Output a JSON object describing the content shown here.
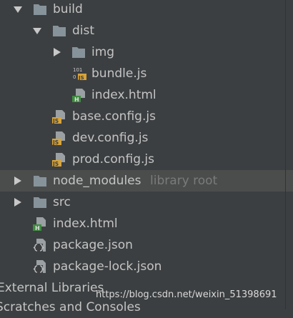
{
  "tree": {
    "build": "build",
    "dist": "dist",
    "img": "img",
    "bundle_js": "bundle.js",
    "dist_index_html": "index.html",
    "base_config": "base.config.js",
    "dev_config": "dev.config.js",
    "prod_config": "prod.config.js",
    "node_modules": "node_modules",
    "node_modules_suffix": "library root",
    "src": "src",
    "index_html": "index.html",
    "package_json": "package.json",
    "package_lock_json": "package-lock.json",
    "external_libraries": "External Libraries",
    "scratches": "Scratches and Consoles"
  },
  "icon_text": {
    "js": "JS",
    "html": "H",
    "bundle_digits_top": "101",
    "bundle_digits_bottom": "0"
  },
  "watermark": "https://blog.csdn.net/weixin_51398691",
  "colors": {
    "background": "#3c3f41",
    "highlight_row": "#4b4d4d",
    "text": "#c4c4c4",
    "muted_text": "#7a7a7a",
    "folder": "#87939a",
    "js_badge": "#d7a33b",
    "html_badge": "#3f8b3f"
  }
}
